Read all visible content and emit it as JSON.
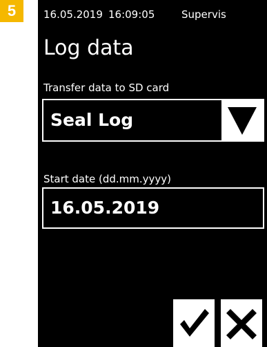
{
  "step_number": "5",
  "status": {
    "date": "16.05.2019",
    "time": "16:09:05",
    "user": "Supervis"
  },
  "page_title": "Log data",
  "transfer": {
    "label": "Transfer data to SD card",
    "selected": "Seal Log"
  },
  "start_date": {
    "label": "Start date (dd.mm.yyyy)",
    "value": "16.05.2019"
  },
  "icons": {
    "dropdown": "triangle-down-icon",
    "confirm": "checkmark-icon",
    "cancel": "x-icon"
  },
  "colors": {
    "badge": "#f5b800",
    "screen_bg": "#000000",
    "foreground": "#ffffff"
  }
}
